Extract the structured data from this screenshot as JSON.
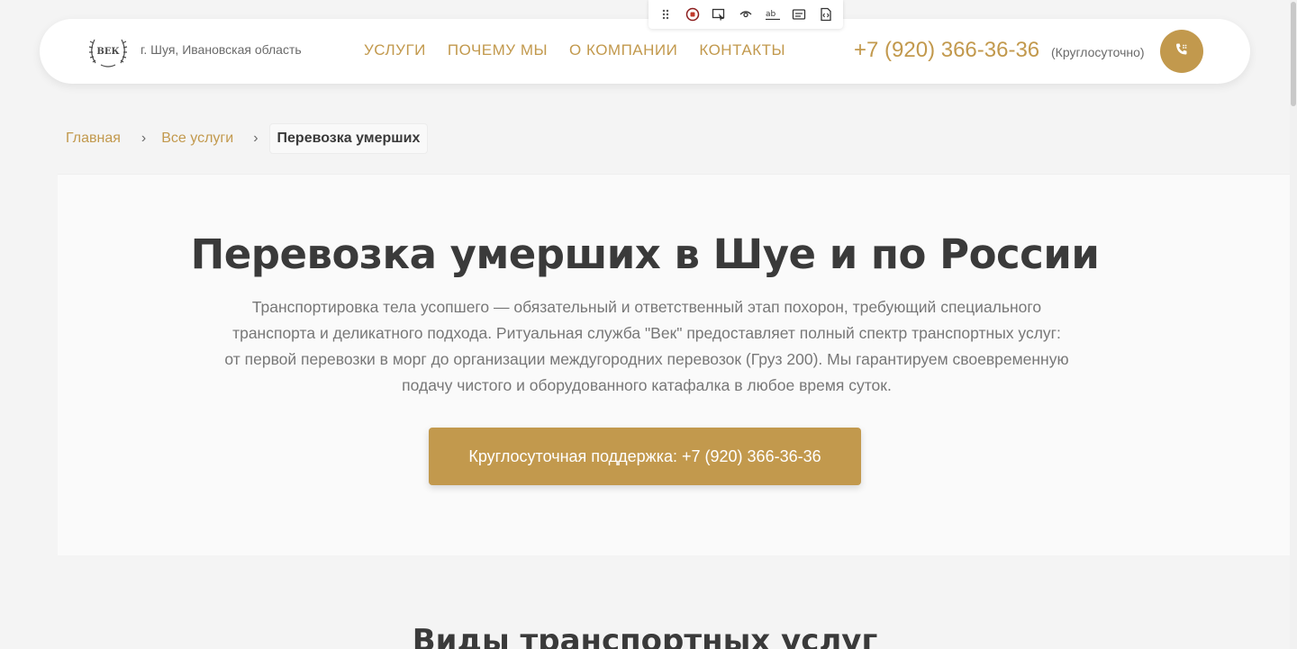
{
  "toolbar": {
    "icons": [
      "drag-handle-icon",
      "record-icon",
      "select-element-icon",
      "eye-icon",
      "text-style-icon",
      "caption-icon",
      "code-icon"
    ]
  },
  "header": {
    "logo_text": "ВЕК",
    "region": "г. Шуя, Ивановская область",
    "nav": [
      "УСЛУГИ",
      "ПОЧЕМУ МЫ",
      "О КОМПАНИИ",
      "КОНТАКТЫ"
    ],
    "phone": "+7 (920) 366-36-36",
    "phone_note": "(Круглосуточно)"
  },
  "breadcrumb": {
    "home": "Главная",
    "services": "Все услуги",
    "current": "Перевозка умерших",
    "separator": "›"
  },
  "hero": {
    "title": "Перевозка умерших в Шуе и по России",
    "description": "Транспортировка тела усопшего — обязательный и ответственный этап похорон, требующий специального транспорта и деликатного подхода. Ритуальная служба \"Век\" предоставляет полный спектр транспортных услуг: от первой перевозки в морг до организации междугородних перевозок (Груз 200). Мы гарантируем своевременную подачу чистого и оборудованного катафалка в любое время суток.",
    "cta": "Круглосуточная поддержка: +7 (920) 366-36-36"
  },
  "next_section": {
    "title": "Виды транспортных услуг"
  },
  "colors": {
    "accent": "#c2994d",
    "background": "#f4f4f4",
    "card": "#ffffff",
    "text": "#3a3a3a",
    "muted": "#777777"
  }
}
